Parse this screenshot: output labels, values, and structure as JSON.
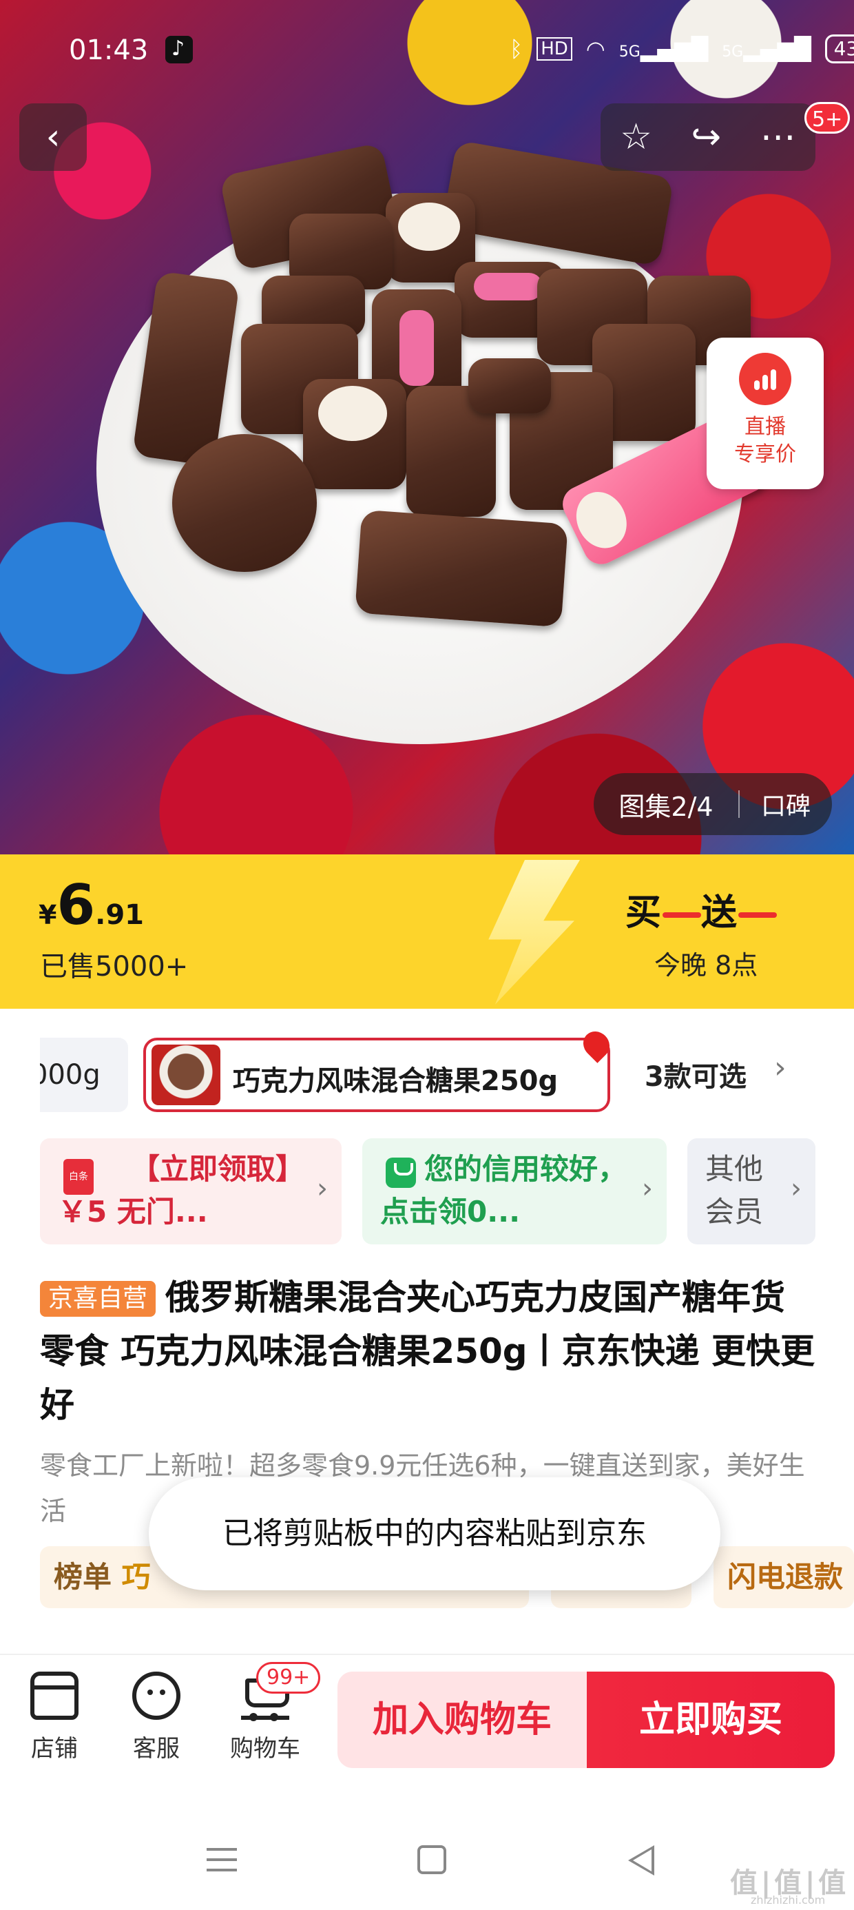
{
  "status_bar": {
    "time": "01:43",
    "network": "5G",
    "battery": "43"
  },
  "top_nav": {
    "back_icon": "chevron-left-icon",
    "favorite_icon": "star-icon",
    "share_icon": "share-icon",
    "more_icon": "ellipsis-icon",
    "notification_badge": "5+"
  },
  "live_promo": {
    "line1": "直播",
    "line2": "专享价"
  },
  "gallery": {
    "counter": "图集2/4",
    "reviews": "口碑"
  },
  "price_banner": {
    "currency": "¥",
    "price_int": "6",
    "price_dec": ".91",
    "sold": "已售5000+",
    "promo_title_a": "买",
    "promo_title_b": "送",
    "promo_sub": "今晚 8点"
  },
  "variants": {
    "prev_label": "000g",
    "active_label": "巧克力风味混合糖果250g",
    "count": "3款可选"
  },
  "coupons": [
    {
      "text": "【立即领取】￥5 无门...",
      "icon_label": "白条"
    },
    {
      "text": "您的信用较好，点击领0..."
    },
    {
      "text": "其他会员"
    }
  ],
  "product": {
    "store_tag": "京喜自营",
    "title": "俄罗斯糖果混合夹心巧克力皮国产糖年货零食 巧克力风味混合糖果250g丨京东快递 更快更好",
    "desc": "零食工厂上新啦！超多零食9.9元任选6种，一键直送到家，美好生活"
  },
  "ranking": {
    "label": "榜单",
    "highlight": "巧",
    "right_label": "闪电退款"
  },
  "toast": "已将剪贴板中的内容粘贴到京东",
  "bottom_bar": {
    "shop": "店铺",
    "service": "客服",
    "cart": "购物车",
    "cart_badge": "99+",
    "add_to_cart": "加入购物车",
    "buy_now": "立即购买"
  },
  "watermark": {
    "main": "值|值|值",
    "sub": "zhizhizhi.com"
  },
  "colors": {
    "price_banner_bg": "#fdd42b",
    "accent_red": "#ec1d3a",
    "store_tag_orange": "#f4853a"
  }
}
